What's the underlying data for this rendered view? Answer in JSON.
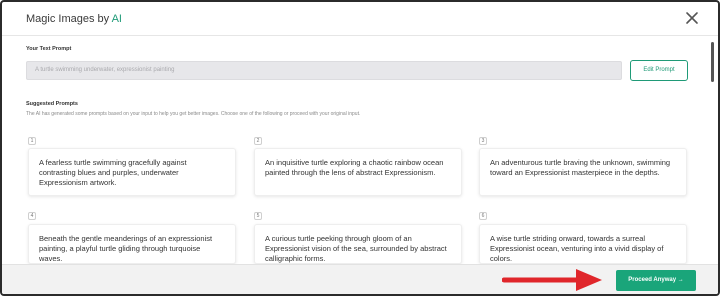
{
  "header": {
    "title": "Magic Images by ",
    "title_accent": "AI"
  },
  "prompt": {
    "label": "Your Text Prompt",
    "value": "A turtle swimming underwater, expressionist painting",
    "edit_label": "Edit Prompt"
  },
  "suggestions": {
    "title": "Suggested Prompts",
    "description": "The AI has generated some prompts based on your input to help you get better images. Choose one of the following or proceed with your original input.",
    "items": [
      {
        "num": "1",
        "text": "A fearless turtle swimming gracefully against contrasting blues and purples, underwater Expressionism artwork."
      },
      {
        "num": "2",
        "text": "An inquisitive turtle exploring a chaotic rainbow ocean painted through the lens of abstract Expressionism."
      },
      {
        "num": "3",
        "text": "An adventurous turtle braving the unknown, swimming toward an Expressionist masterpiece in the depths."
      },
      {
        "num": "4",
        "text": "Beneath the gentle meanderings of an expressionist painting, a playful turtle gliding through turquoise waves."
      },
      {
        "num": "5",
        "text": "A curious turtle peeking through gloom of an Expressionist vision of the sea, surrounded by abstract calligraphic forms."
      },
      {
        "num": "6",
        "text": "A wise turtle striding onward, towards a surreal Expressionist ocean, venturing into a vivid display of colors."
      }
    ]
  },
  "footer": {
    "proceed_label": "Proceed Anyway →"
  },
  "colors": {
    "accent": "#1aa57a",
    "arrow": "#e0262b"
  },
  "icons": {
    "close": "close-icon",
    "annotation": "red-arrow-icon"
  }
}
